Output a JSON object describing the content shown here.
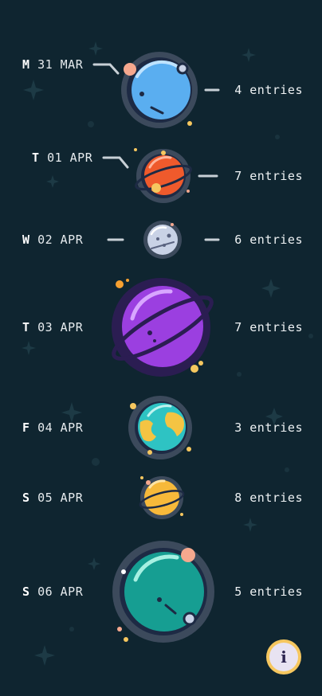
{
  "days": [
    {
      "letter": "M",
      "date": "31 MAR",
      "entries": "4 entries"
    },
    {
      "letter": "T",
      "date": "01 APR",
      "entries": "7 entries"
    },
    {
      "letter": "W",
      "date": "02 APR",
      "entries": "6 entries"
    },
    {
      "letter": "T",
      "date": "03 APR",
      "entries": "7 entries"
    },
    {
      "letter": "F",
      "date": "04 APR",
      "entries": "3 entries"
    },
    {
      "letter": "S",
      "date": "05 APR",
      "entries": "8 entries"
    },
    {
      "letter": "S",
      "date": "06 APR",
      "entries": "5 entries"
    }
  ],
  "info_button": {
    "label": "i"
  },
  "colors": {
    "background": "#0f2530",
    "planet_blue": "#5aaef0",
    "planet_orange": "#ef5a2c",
    "planet_moon": "#c9d2e6",
    "planet_purple": "#9b3fe0",
    "planet_earth_water": "#2ec3c3",
    "planet_earth_land": "#f4c443",
    "planet_yellow": "#f7b93a",
    "planet_teal": "#169e92",
    "accent_yellow": "#f6c75f"
  }
}
